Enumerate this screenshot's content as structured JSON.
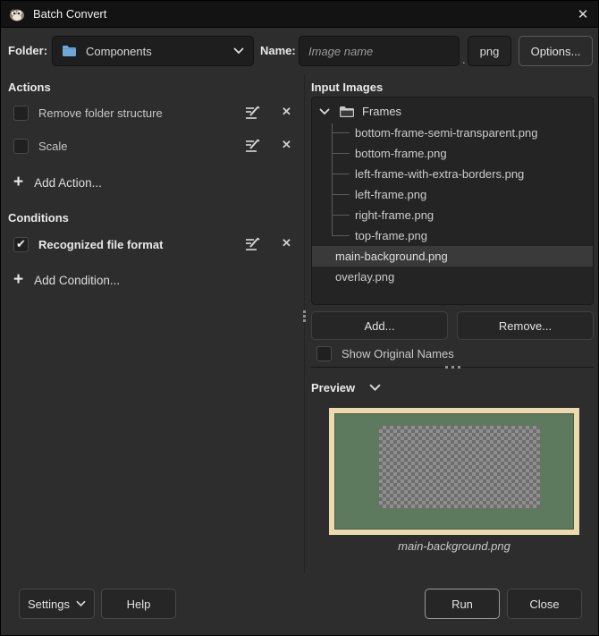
{
  "window": {
    "title": "Batch Convert",
    "close_glyph": "✕"
  },
  "toolbar": {
    "folder_label": "Folder:",
    "folder_value": "Components",
    "name_label": "Name:",
    "name_placeholder": "Image name",
    "extension_separator": ".",
    "extension": "png",
    "options_label": "Options..."
  },
  "actions": {
    "header": "Actions",
    "items": [
      {
        "label": "Remove folder structure",
        "checked": false
      },
      {
        "label": "Scale",
        "checked": false
      }
    ],
    "add_label": "Add Action...",
    "remove_glyph": "✕",
    "plus_glyph": "+"
  },
  "conditions": {
    "header": "Conditions",
    "items": [
      {
        "label": "Recognized file format",
        "checked": true
      }
    ],
    "add_label": "Add Condition..."
  },
  "input_images": {
    "header": "Input Images",
    "folder_name": "Frames",
    "tree_items": [
      "bottom-frame-semi-transparent.png",
      "bottom-frame.png",
      "left-frame-with-extra-borders.png",
      "left-frame.png",
      "right-frame.png",
      "top-frame.png"
    ],
    "root_items": [
      {
        "label": "main-background.png",
        "selected": true
      },
      {
        "label": "overlay.png",
        "selected": false
      }
    ],
    "add_button": "Add...",
    "remove_button": "Remove...",
    "show_original_names": "Show Original Names"
  },
  "preview": {
    "header": "Preview",
    "caption": "main-background.png",
    "colors": {
      "frame": "#ecd9ad",
      "background": "#5d7a5e",
      "checker_light": "#8f8f8f",
      "checker_dark": "#6e6e6e"
    }
  },
  "footer": {
    "settings": "Settings",
    "help": "Help",
    "run": "Run",
    "close": "Close"
  }
}
